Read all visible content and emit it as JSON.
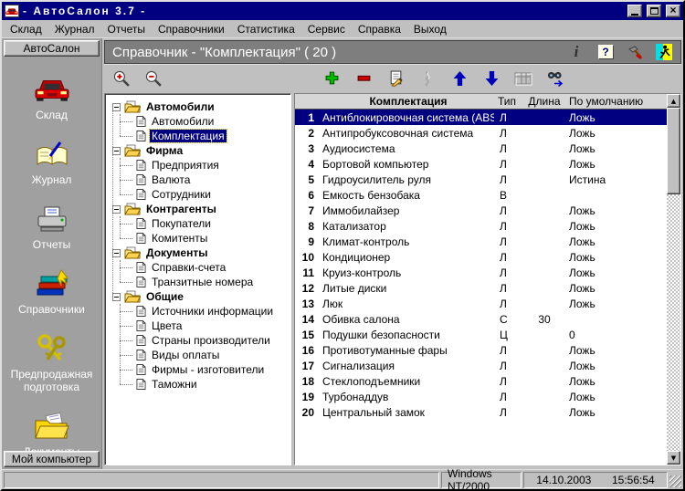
{
  "colors": {
    "titlebar": "#000080",
    "selection": "#000080",
    "header_bar": "#7e7e7e",
    "sidebar_bg": "#a0a0a0",
    "window_bg": "#c0c0c0"
  },
  "window": {
    "title": "- АвтоСалон 3.7 -",
    "controls": [
      "minimize",
      "maximize",
      "close"
    ]
  },
  "menu": {
    "items": [
      {
        "id": "sklad",
        "label": "Склад"
      },
      {
        "id": "zhurnal",
        "label": "Журнал"
      },
      {
        "id": "otchety",
        "label": "Отчеты"
      },
      {
        "id": "spravochniki",
        "label": "Справочники"
      },
      {
        "id": "statistika",
        "label": "Статистика"
      },
      {
        "id": "servis",
        "label": "Сервис"
      },
      {
        "id": "spravka",
        "label": "Справка"
      },
      {
        "id": "vyhod",
        "label": "Выход"
      }
    ]
  },
  "sidebar": {
    "top_button": "АвтоСалон",
    "bottom_button": "Мой компьютер",
    "items": [
      {
        "id": "sklad",
        "label": "Склад",
        "icon": "car-icon"
      },
      {
        "id": "zhurnal",
        "label": "Журнал",
        "icon": "journal-icon"
      },
      {
        "id": "otchety",
        "label": "Отчеты",
        "icon": "printer-icon"
      },
      {
        "id": "spravochniki",
        "label": "Справочники",
        "icon": "books-icon"
      },
      {
        "id": "predprodazhnaya-podgotovka",
        "label": "Предпродажная подготовка",
        "icon": "keys-icon"
      },
      {
        "id": "dokumenty",
        "label": "Документы",
        "icon": "folder-icon"
      }
    ]
  },
  "main": {
    "header_title": "Справочник - \"Комплектация\" ( 20 )",
    "header_icons": [
      {
        "id": "info",
        "icon": "info-icon"
      },
      {
        "id": "help",
        "icon": "help-icon"
      },
      {
        "id": "tools",
        "icon": "tools-icon"
      },
      {
        "id": "exit",
        "icon": "exit-icon"
      }
    ]
  },
  "toolbar": {
    "buttons": [
      {
        "id": "zoom-in",
        "icon": "zoom-in-icon",
        "disabled": false,
        "gap": false
      },
      {
        "id": "zoom-out",
        "icon": "zoom-out-icon",
        "disabled": false,
        "gap": false
      },
      {
        "id": "add",
        "icon": "add-icon",
        "disabled": false,
        "gap": true
      },
      {
        "id": "delete",
        "icon": "remove-icon",
        "disabled": false,
        "gap": false
      },
      {
        "id": "edit",
        "icon": "edit-icon",
        "disabled": false,
        "gap": false
      },
      {
        "id": "clip",
        "icon": "clip-disabled-icon",
        "disabled": true,
        "gap": false
      },
      {
        "id": "move-up",
        "icon": "arrow-up-icon",
        "disabled": false,
        "gap": false
      },
      {
        "id": "move-down",
        "icon": "arrow-down-icon",
        "disabled": false,
        "gap": false
      },
      {
        "id": "grid",
        "icon": "grid-disabled-icon",
        "disabled": true,
        "gap": false
      },
      {
        "id": "find-next",
        "icon": "find-next-icon",
        "disabled": false,
        "gap": false
      }
    ]
  },
  "tree": {
    "selected": "Комплектация",
    "groups": [
      {
        "id": "avtomobili",
        "label": "Автомобили",
        "children": [
          "Автомобили",
          "Комплектация"
        ]
      },
      {
        "id": "firma",
        "label": "Фирма",
        "children": [
          "Предприятия",
          "Валюта",
          "Сотрудники"
        ]
      },
      {
        "id": "kontragenty",
        "label": "Контрагенты",
        "children": [
          "Покупатели",
          "Комитенты"
        ]
      },
      {
        "id": "dokumenty",
        "label": "Документы",
        "children": [
          "Справки-счета",
          "Транзитные номера"
        ]
      },
      {
        "id": "obschie",
        "label": "Общие",
        "children": [
          "Источники информации",
          "Цвета",
          "Страны производители",
          "Виды оплаты",
          "Фирмы - изготовители",
          "Таможни"
        ]
      }
    ]
  },
  "table": {
    "columns": [
      "",
      "Комплектация",
      "Тип",
      "Длина",
      "По умолчанию"
    ],
    "selected_row": 1,
    "rows": [
      [
        1,
        "Антиблокировочная система (ABS)",
        "Л",
        "",
        "Ложь"
      ],
      [
        2,
        "Антипробуксовочная система",
        "Л",
        "",
        "Ложь"
      ],
      [
        3,
        "Аудиосистема",
        "Л",
        "",
        "Ложь"
      ],
      [
        4,
        "Бортовой компьютер",
        "Л",
        "",
        "Ложь"
      ],
      [
        5,
        "Гидроусилитель руля",
        "Л",
        "",
        "Истина"
      ],
      [
        6,
        "Емкость бензобака",
        "В",
        "",
        ""
      ],
      [
        7,
        "Иммобилайзер",
        "Л",
        "",
        "Ложь"
      ],
      [
        8,
        "Катализатор",
        "Л",
        "",
        "Ложь"
      ],
      [
        9,
        "Климат-контроль",
        "Л",
        "",
        "Ложь"
      ],
      [
        10,
        "Кондиционер",
        "Л",
        "",
        "Ложь"
      ],
      [
        11,
        "Круиз-контроль",
        "Л",
        "",
        "Ложь"
      ],
      [
        12,
        "Литые диски",
        "Л",
        "",
        "Ложь"
      ],
      [
        13,
        "Люк",
        "Л",
        "",
        "Ложь"
      ],
      [
        14,
        "Обивка салона",
        "С",
        "30",
        ""
      ],
      [
        15,
        "Подушки безопасности",
        "Ц",
        "",
        "0"
      ],
      [
        16,
        "Противотуманные фары",
        "Л",
        "",
        "Ложь"
      ],
      [
        17,
        "Сигнализация",
        "Л",
        "",
        "Ложь"
      ],
      [
        18,
        "Стеклоподъемники",
        "Л",
        "",
        "Ложь"
      ],
      [
        19,
        "Турбонаддув",
        "Л",
        "",
        "Ложь"
      ],
      [
        20,
        "Центральный замок",
        "Л",
        "",
        "Ложь"
      ]
    ]
  },
  "statusbar": {
    "message": "",
    "os": "Windows NT/2000",
    "date": "14.10.2003",
    "time": "15:56:54"
  }
}
